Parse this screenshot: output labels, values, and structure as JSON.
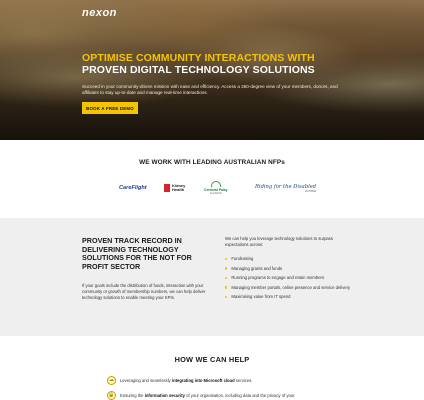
{
  "hero": {
    "logo": "nexon",
    "title_line1": "OPTIMISE COMMUNITY INTERACTIONS WITH",
    "title_line2": "PROVEN DIGITAL TECHNOLOGY SOLUTIONS",
    "subtitle": "Succeed in your community-driven mission with ease and efficiency. Access a 360-degree view of your members, donors, and affiliates to stay up-to-date and manage real-time interactions.",
    "cta": "BOOK A FREE DEMO"
  },
  "partners": {
    "title": "WE WORK WITH LEADING AUSTRALIAN NFPs",
    "logos": {
      "careflight": "CareFlight",
      "kidney": "Kidney Health",
      "cerebral": "Cerebral Palsy",
      "cerebral_small": "ALLIANCE",
      "rda": "Riding for the Disabled",
      "rda_small": "VICTORIA"
    }
  },
  "track": {
    "title": "PROVEN TRACK RECORD IN DELIVERING TECHNOLOGY SOLUTIONS FOR THE NOT FOR PROFIT SECTOR",
    "body": "If your goals include the distribution of funds, interaction with your community or growth of membership numbers, we can help deliver technology solutions to enable meeting your KPIs.",
    "intro": "We can help you leverage technology solutions to surpass expectations across:",
    "bullets": [
      "Fundraising",
      "Managing grants and funds",
      "Running programs to engage and retain members",
      "Managing member portals, online presence and service delivery",
      "Maximising value from IT spend"
    ]
  },
  "help": {
    "title": "HOW WE CAN HELP",
    "items": [
      {
        "pre": "Leveraging and seamlessly ",
        "bold": "integrating into Microsoft cloud",
        "post": " services.",
        "icon": "cloud-icon"
      },
      {
        "pre": "Ensuring the ",
        "bold": "information security",
        "post": " of your organisation, including data and the privacy of your",
        "icon": "lock-icon"
      }
    ]
  },
  "colors": {
    "accent": "#f5c400",
    "track_bg": "#efefef"
  }
}
